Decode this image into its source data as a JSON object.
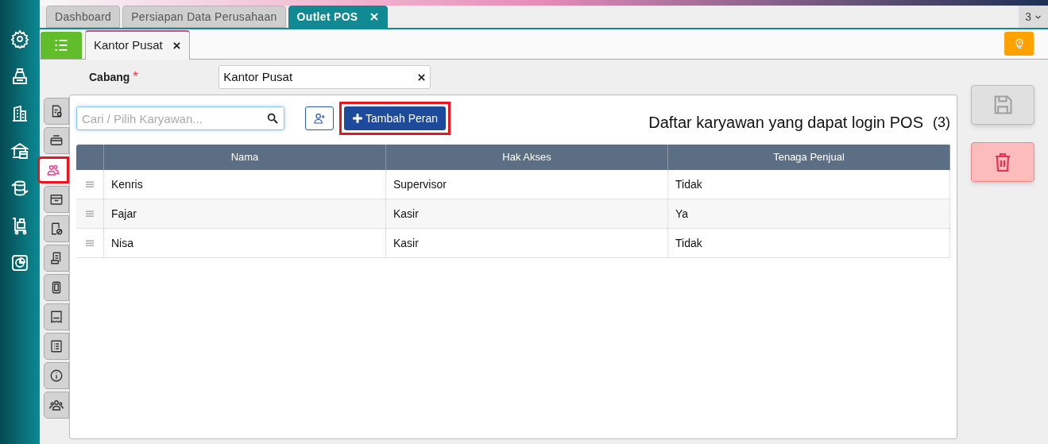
{
  "main_tabs": [
    {
      "label": "Dashboard",
      "selected": false,
      "closable": false
    },
    {
      "label": "Persiapan Data Perusahaan",
      "selected": false,
      "closable": false
    },
    {
      "label": "Outlet POS",
      "selected": true,
      "closable": true
    }
  ],
  "tab_count": "3",
  "sub_tabs": [
    {
      "label": "Kantor Pusat",
      "selected": true
    }
  ],
  "branch": {
    "label": "Cabang",
    "required_mark": "*",
    "value": "Kantor Pusat"
  },
  "side_tabs": [
    {
      "selected": false
    },
    {
      "selected": false
    },
    {
      "selected": true
    },
    {
      "selected": false
    },
    {
      "selected": false
    },
    {
      "selected": false
    },
    {
      "selected": false
    },
    {
      "selected": false
    },
    {
      "selected": false
    },
    {
      "selected": false
    },
    {
      "selected": false
    }
  ],
  "search": {
    "placeholder": "Cari / Pilih Karyawan..."
  },
  "add_role_button": {
    "label": "Tambah Peran",
    "highlighted": true
  },
  "list_title": "Daftar karyawan yang dapat login POS",
  "list_count": "(3)",
  "table": {
    "columns": [
      "Nama",
      "Hak Akses",
      "Tenaga Penjual"
    ],
    "rows": [
      [
        "Kenris",
        "Supervisor",
        "Tidak"
      ],
      [
        "Fajar",
        "Kasir",
        "Ya"
      ],
      [
        "Nisa",
        "Kasir",
        "Tidak"
      ]
    ]
  }
}
